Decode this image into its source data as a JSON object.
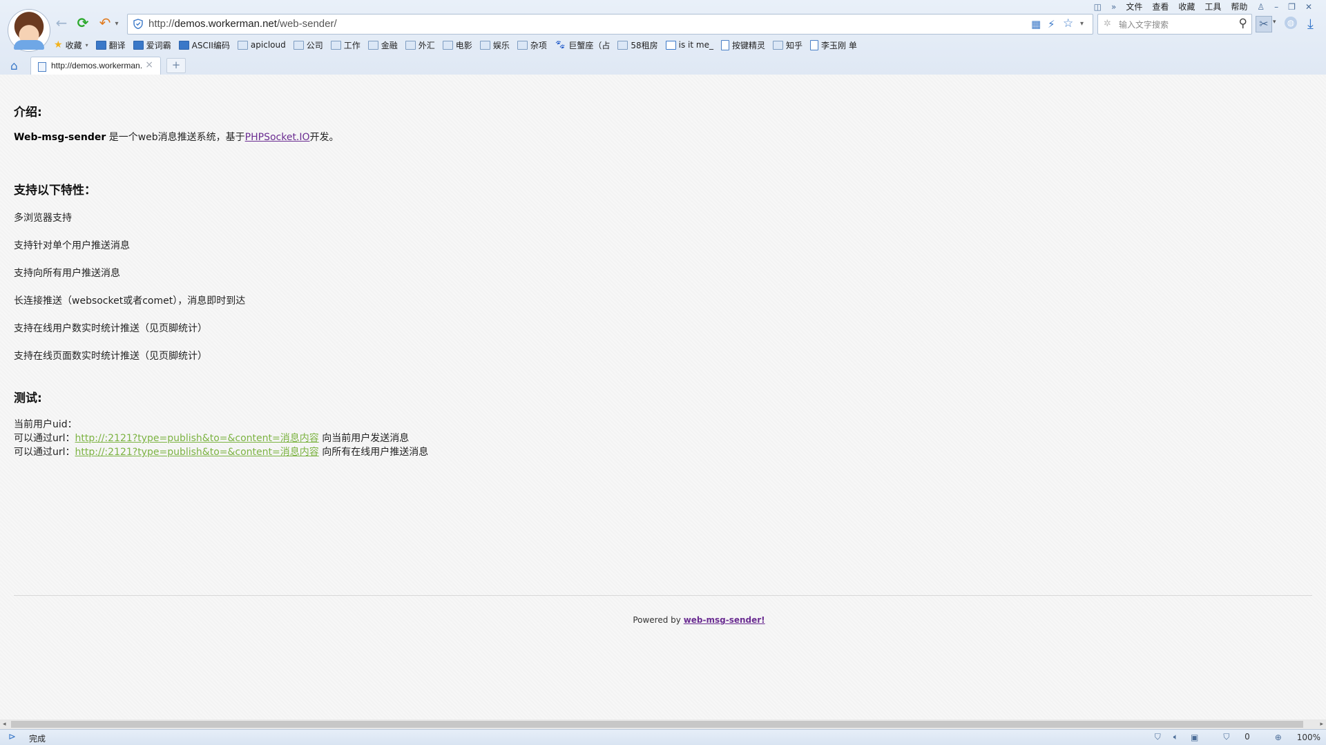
{
  "browser": {
    "menu": [
      "文件",
      "查看",
      "收藏",
      "工具",
      "帮助"
    ],
    "url_prefix": "http://",
    "url_host": "demos.workerman.net",
    "url_path": "/web-sender/",
    "search_placeholder": "输入文字搜索",
    "bookmarks": [
      {
        "label": "收藏",
        "icon": "star"
      },
      {
        "label": "翻译",
        "icon": "blue"
      },
      {
        "label": "爱词霸",
        "icon": "blue"
      },
      {
        "label": "ASCII编码",
        "icon": "blue"
      },
      {
        "label": "apicloud",
        "icon": "folder"
      },
      {
        "label": "公司",
        "icon": "folder"
      },
      {
        "label": "工作",
        "icon": "folder"
      },
      {
        "label": "金融",
        "icon": "folder"
      },
      {
        "label": "外汇",
        "icon": "folder"
      },
      {
        "label": "电影",
        "icon": "folder"
      },
      {
        "label": "娱乐",
        "icon": "folder"
      },
      {
        "label": "杂项",
        "icon": "folder"
      },
      {
        "label": "巨蟹座（占",
        "icon": "paw"
      },
      {
        "label": "58租房",
        "icon": "folder"
      },
      {
        "label": "is it me_",
        "icon": "cal"
      },
      {
        "label": "按键精灵",
        "icon": "doc"
      },
      {
        "label": "知乎",
        "icon": "folder"
      },
      {
        "label": "李玉刚 单",
        "icon": "doc"
      }
    ],
    "tab_title": "http://demos.workerman.net/web-sender/",
    "new_tab_label": "+",
    "status_text": "完成",
    "status_count": "0",
    "zoom": "100%"
  },
  "page": {
    "intro_heading": "介绍:",
    "intro_bold": "Web-msg-sender",
    "intro_text_1": " 是一个web消息推送系统，基于",
    "intro_link": "PHPSocket.IO",
    "intro_text_2": "开发。",
    "features_heading": "支持以下特性：",
    "features": [
      "多浏览器支持",
      "支持针对单个用户推送消息",
      "支持向所有用户推送消息",
      "长连接推送（websocket或者comet），消息即时到达",
      "支持在线用户数实时统计推送（见页脚统计）",
      "支持在线页面数实时统计推送（见页脚统计）"
    ],
    "test_heading": "测试:",
    "test_uid_label": "当前用户uid：",
    "test_line_prefix": "可以通过url：",
    "test_link_1": "http://:2121?type=publish&to=&content=消息内容",
    "test_suffix_1": " 向当前用户发送消息",
    "test_link_2": "http://:2121?type=publish&to=&content=消息内容",
    "test_suffix_2": " 向所有在线用户推送消息",
    "footer_prefix": "Powered by ",
    "footer_link": "web-msg-sender!"
  }
}
